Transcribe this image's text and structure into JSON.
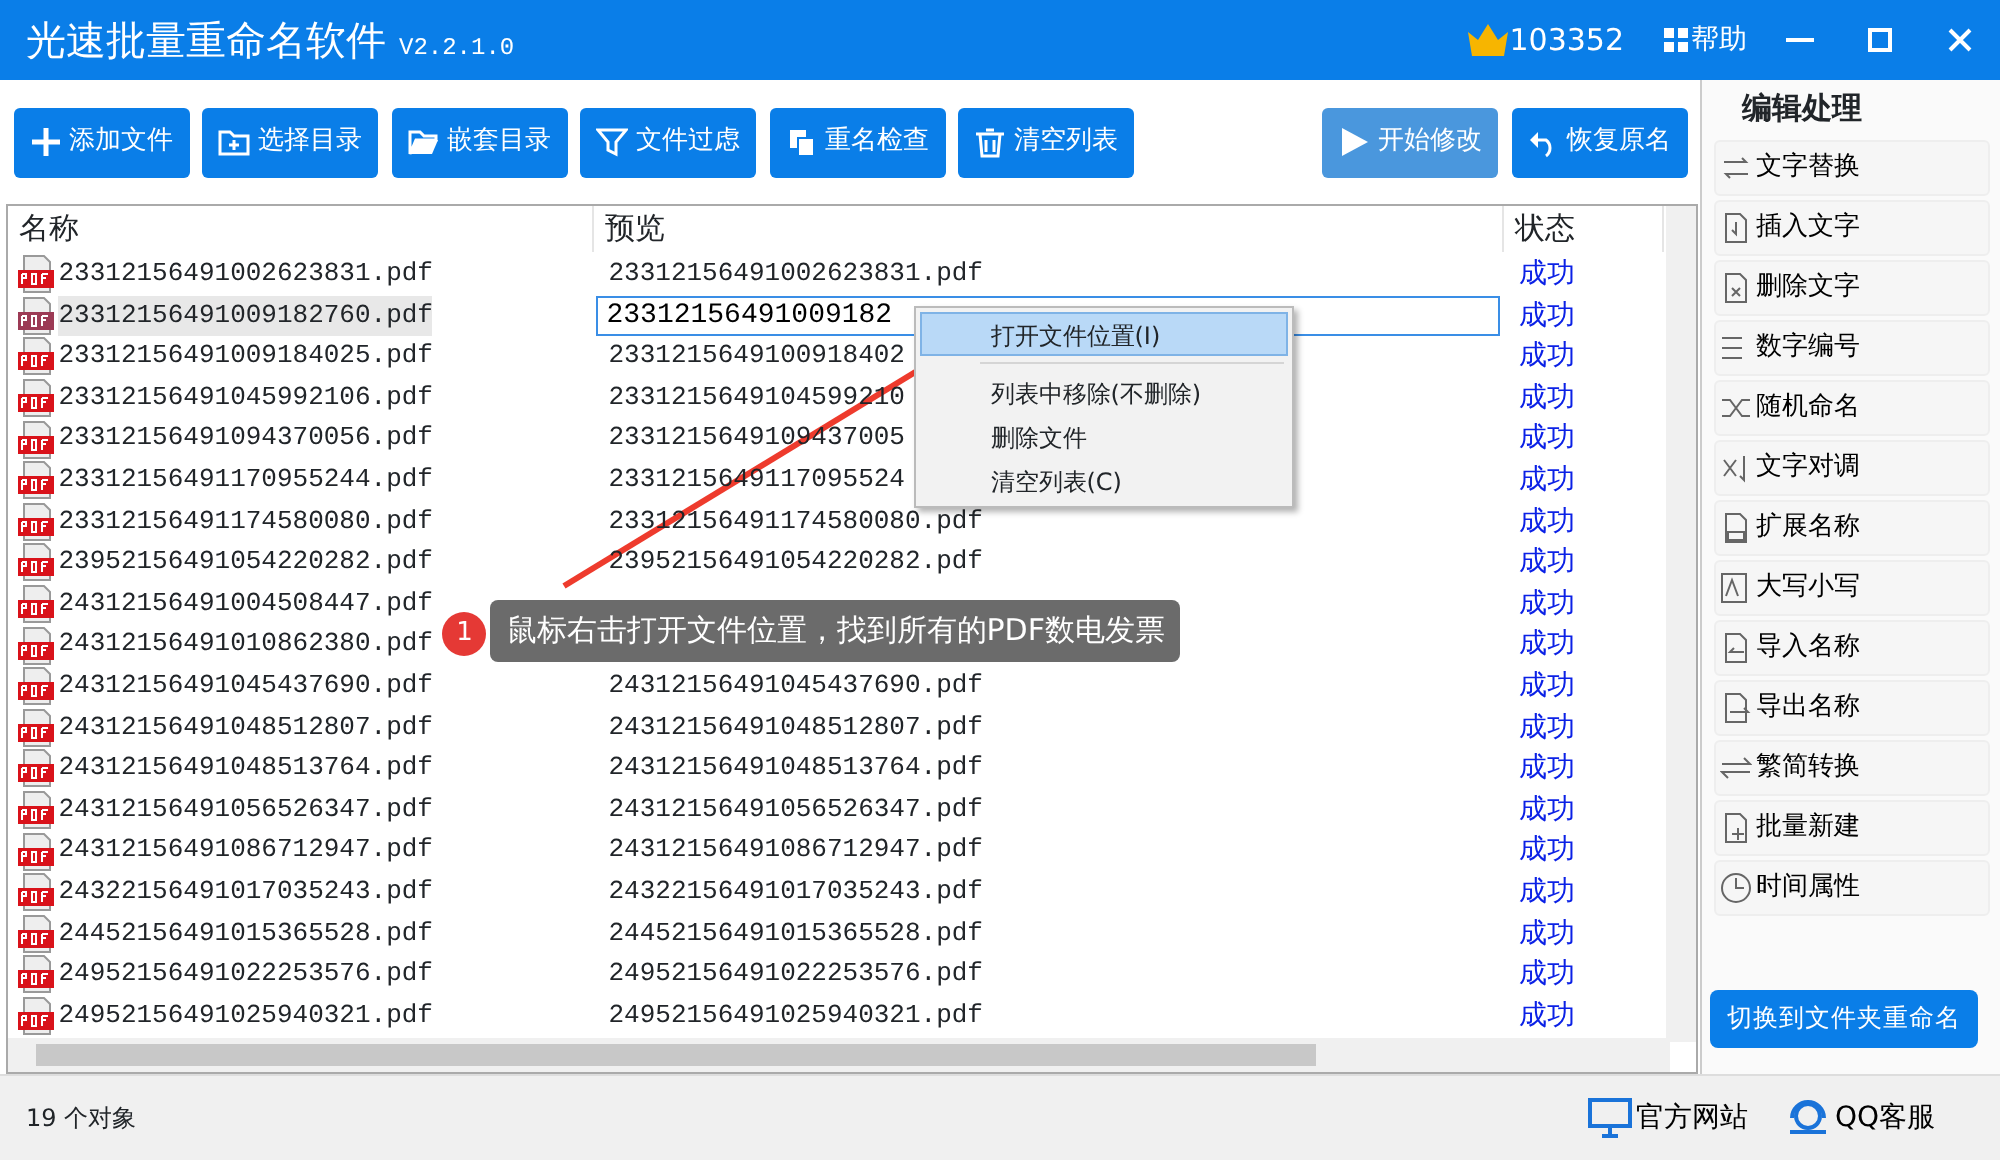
{
  "window": {
    "title": "光速批量重命名软件",
    "version": "V2.2.1.0",
    "user_id": "103352",
    "help": "帮助"
  },
  "toolbar": [
    {
      "label": "添加文件",
      "kind": "add",
      "disabled": false
    },
    {
      "label": "选择目录",
      "kind": "folder",
      "disabled": false
    },
    {
      "label": "嵌套目录",
      "kind": "folder-open",
      "disabled": false
    },
    {
      "label": "文件过虑",
      "kind": "filter",
      "disabled": false
    },
    {
      "label": "重名检查",
      "kind": "copy",
      "disabled": false
    },
    {
      "label": "清空列表",
      "kind": "trash",
      "disabled": false
    }
  ],
  "toolbar_right": [
    {
      "label": "开始修改",
      "kind": "play",
      "disabled": true
    },
    {
      "label": "恢复原名",
      "kind": "undo",
      "disabled": false
    }
  ],
  "table": {
    "columns": [
      "名称",
      "预览",
      "状态"
    ],
    "rows": [
      {
        "name": "23312156491002623831.pdf",
        "preview": "23312156491002623831.pdf",
        "status": "成功",
        "selected": false
      },
      {
        "name": "23312156491009182760.pdf",
        "preview": "23312156491009182",
        "status": "成功",
        "selected": true
      },
      {
        "name": "23312156491009184025.pdf",
        "preview": "2331215649100918402",
        "status": "成功",
        "selected": false
      },
      {
        "name": "23312156491045992106.pdf",
        "preview": "2331215649104599210",
        "status": "成功",
        "selected": false
      },
      {
        "name": "23312156491094370056.pdf",
        "preview": "2331215649109437005",
        "status": "成功",
        "selected": false
      },
      {
        "name": "23312156491170955244.pdf",
        "preview": "2331215649117095524",
        "status": "成功",
        "selected": false
      },
      {
        "name": "23312156491174580080.pdf",
        "preview": "23312156491174580080.pdf",
        "status": "成功",
        "selected": false
      },
      {
        "name": "23952156491054220282.pdf",
        "preview": "23952156491054220282.pdf",
        "status": "成功",
        "selected": false
      },
      {
        "name": "24312156491004508447.pdf",
        "status": "成功",
        "selected": false
      },
      {
        "name": "24312156491010862380.pdf",
        "status": "成功",
        "selected": false
      },
      {
        "name": "24312156491045437690.pdf",
        "preview": "24312156491045437690.pdf",
        "status": "成功",
        "selected": false
      },
      {
        "name": "24312156491048512807.pdf",
        "preview": "24312156491048512807.pdf",
        "status": "成功",
        "selected": false
      },
      {
        "name": "24312156491048513764.pdf",
        "preview": "24312156491048513764.pdf",
        "status": "成功",
        "selected": false
      },
      {
        "name": "24312156491056526347.pdf",
        "preview": "24312156491056526347.pdf",
        "status": "成功",
        "selected": false
      },
      {
        "name": "24312156491086712947.pdf",
        "preview": "24312156491086712947.pdf",
        "status": "成功",
        "selected": false
      },
      {
        "name": "24322156491017035243.pdf",
        "preview": "24322156491017035243.pdf",
        "status": "成功",
        "selected": false
      },
      {
        "name": "24452156491015365528.pdf",
        "preview": "24452156491015365528.pdf",
        "status": "成功",
        "selected": false
      },
      {
        "name": "24952156491022253576.pdf",
        "preview": "24952156491022253576.pdf",
        "status": "成功",
        "selected": false
      },
      {
        "name": "24952156491025940321.pdf",
        "preview": "24952156491025940321.pdf",
        "status": "成功",
        "selected": false
      }
    ]
  },
  "context_menu": [
    {
      "label": "打开文件位置(I)",
      "selected": true
    },
    {
      "label": "列表中移除(不删除)",
      "selected": false
    },
    {
      "label": "删除文件",
      "selected": false
    },
    {
      "label": "清空列表(C)",
      "selected": false
    }
  ],
  "callout": {
    "number": "1",
    "text": "鼠标右击打开文件位置，找到所有的PDF数电发票"
  },
  "sidebar": {
    "title": "编辑处理",
    "items": [
      "文字替换",
      "插入文字",
      "删除文字",
      "数字编号",
      "随机命名",
      "文字对调",
      "扩展名称",
      "大写小写",
      "导入名称",
      "导出名称",
      "繁简转换",
      "批量新建",
      "时间属性"
    ],
    "switch_button": "切换到文件夹重命名"
  },
  "status_bar": {
    "count": "19 个对象",
    "links": [
      "官方网站",
      "QQ客服"
    ]
  }
}
